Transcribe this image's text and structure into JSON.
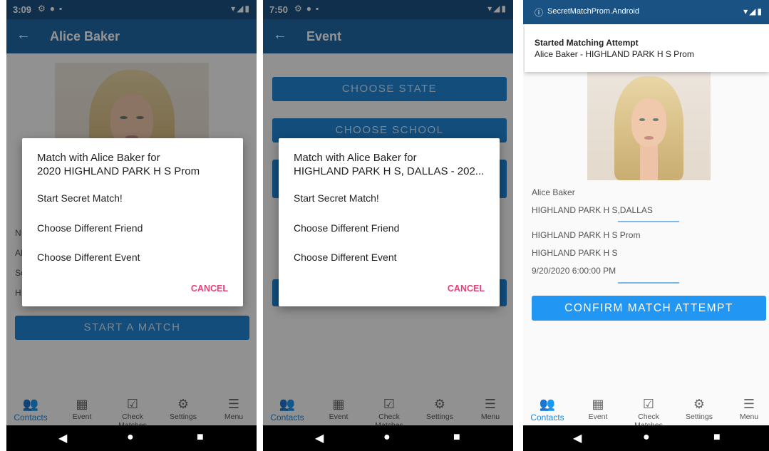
{
  "screens": [
    {
      "status_time": "3:09",
      "title": "Alice Baker",
      "list_labels": [
        "N",
        "Al",
        "Sc",
        "H"
      ],
      "start_button": "START A MATCH",
      "dialog": {
        "title_line1": "Match with Alice Baker for",
        "title_line2": "2020 HIGHLAND PARK H S Prom",
        "options": [
          "Start Secret Match!",
          "Choose Different Friend",
          "Choose Different Event"
        ],
        "cancel": "CANCEL"
      }
    },
    {
      "status_time": "7:50",
      "title": "Event",
      "buttons": [
        "CHOOSE STATE",
        "CHOOSE SCHOOL"
      ],
      "dialog": {
        "title_line1": "Match with Alice Baker for",
        "title_line2": "HIGHLAND PARK H S, DALLAS - 202...",
        "options": [
          "Start Secret Match!",
          "Choose Different Friend",
          "Choose Different Event"
        ],
        "cancel": "CANCEL"
      }
    },
    {
      "status_app": "SecretMatchProm.Android",
      "notification": {
        "title": "Started Matching Attempt",
        "body": "Alice Baker - HIGHLAND PARK H S Prom"
      },
      "info": {
        "name": "Alice Baker",
        "school_city": "HIGHLAND PARK H S,DALLAS",
        "event": "HIGHLAND PARK H S Prom",
        "school": "HIGHLAND PARK H S",
        "datetime": "9/20/2020 6:00:00 PM"
      },
      "confirm_button": "CONFIRM MATCH ATTEMPT"
    }
  ],
  "nav": {
    "contacts": "Contacts",
    "event": "Event",
    "check_matches": "Check Matches",
    "settings": "Settings",
    "menu": "Menu"
  },
  "colors": {
    "status_bar": "#1a5283",
    "app_bar": "#1f6aa8",
    "accent": "#1f86d6",
    "cancel": "#e5407a"
  }
}
